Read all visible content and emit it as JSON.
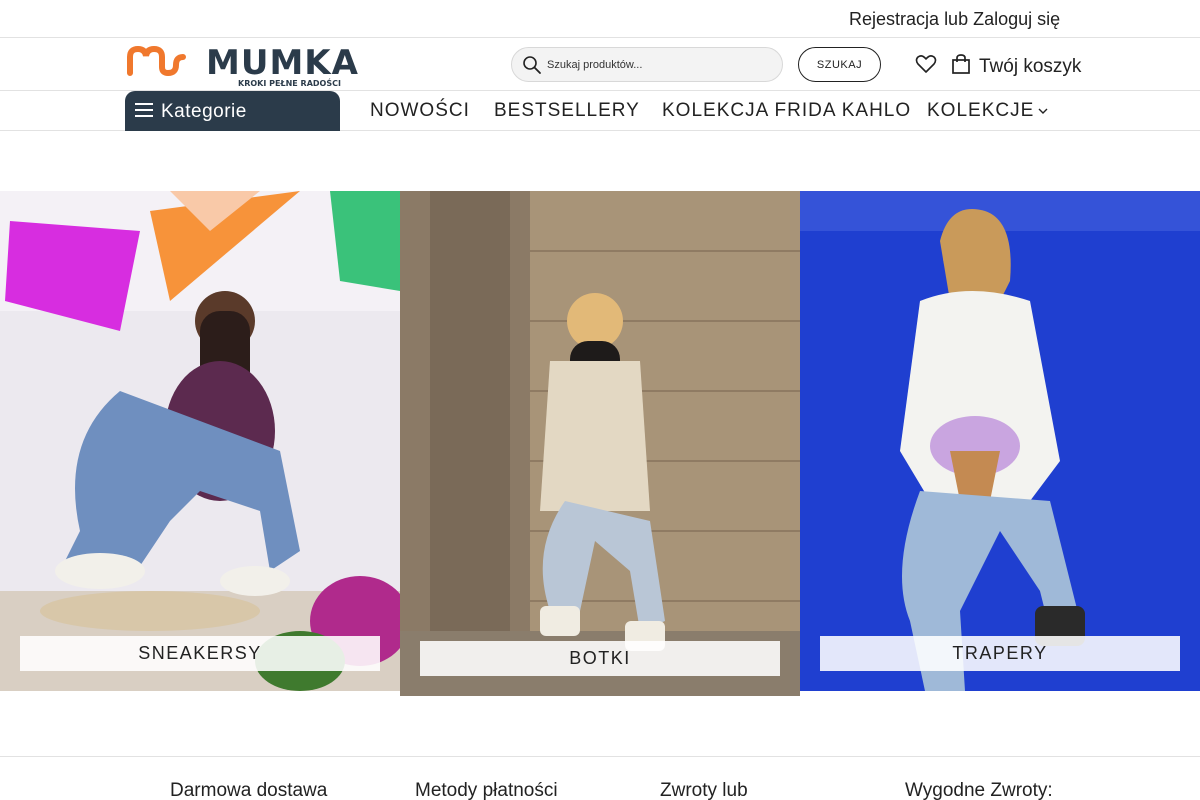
{
  "topbar": {
    "register": "Rejestracja",
    "or": "lub",
    "login": "Zaloguj się"
  },
  "header": {
    "brand": "MUMKA",
    "tagline": "KROKI PEŁNE RADOŚCI",
    "search": {
      "placeholder": "Szukaj produktów...",
      "button": "SZUKAJ"
    },
    "cart_label": "Twój koszyk"
  },
  "nav": {
    "categories_label": "Kategorie",
    "items": [
      {
        "label": "NOWOŚCI"
      },
      {
        "label": "BESTSELLERY"
      },
      {
        "label": "KOLEKCJA FRIDA KAHLO"
      },
      {
        "label": "KOLEKCJE"
      }
    ]
  },
  "banners": [
    {
      "label": "SNEAKERSY"
    },
    {
      "label": "BOTKI"
    },
    {
      "label": "TRAPERY"
    }
  ],
  "benefits": [
    {
      "label": "Darmowa dostawa"
    },
    {
      "label": "Metody płatności"
    },
    {
      "label": "Zwroty lub"
    },
    {
      "label": "Wygodne Zwroty:"
    }
  ],
  "colors": {
    "accent_orange": "#f0782d",
    "brand_dark": "#2b3b4a",
    "tile_blue": "#1f3fd0"
  },
  "icons": [
    "search-icon",
    "heart-icon",
    "shopping-bag-icon",
    "menu-icon",
    "chevron-down-icon"
  ]
}
